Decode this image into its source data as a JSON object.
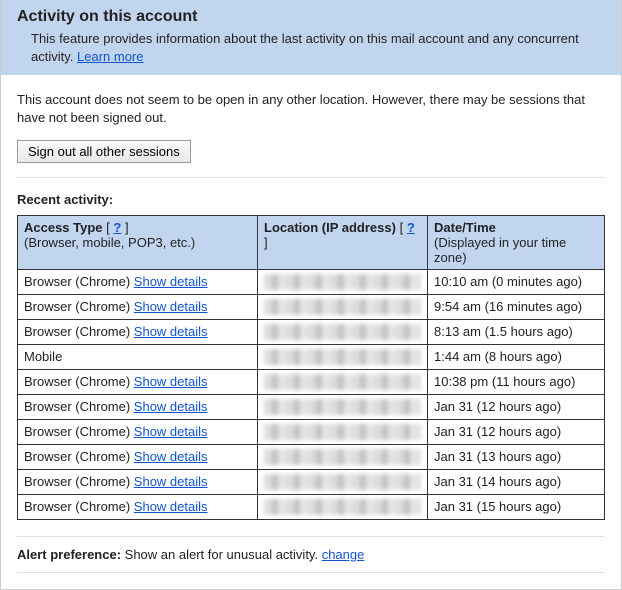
{
  "header": {
    "title": "Activity on this account",
    "subtitle_a": "This feature provides information about the last activity on this mail account and any concurrent activity. ",
    "learn_more": "Learn more"
  },
  "status": "This account does not seem to be open in any other location. However, there may be sessions that have not been signed out.",
  "signout_label": "Sign out all other sessions",
  "recent_label": "Recent activity:",
  "table": {
    "col_access_main": "Access Type",
    "col_access_sub": "(Browser, mobile, POP3, etc.)",
    "col_location_main": "Location (IP address)",
    "col_date_main": "Date/Time",
    "col_date_sub": "(Displayed in your time zone)",
    "help_q": "?",
    "show_details": "Show details",
    "rows": [
      {
        "access": "Browser (Chrome) ",
        "has_details": true,
        "datetime": "10:10 am (0 minutes ago)"
      },
      {
        "access": "Browser (Chrome) ",
        "has_details": true,
        "datetime": "9:54 am (16 minutes ago)"
      },
      {
        "access": "Browser (Chrome) ",
        "has_details": true,
        "datetime": "8:13 am (1.5 hours ago)"
      },
      {
        "access": "Mobile",
        "has_details": false,
        "datetime": "1:44 am (8 hours ago)"
      },
      {
        "access": "Browser (Chrome) ",
        "has_details": true,
        "datetime": "10:38 pm (11 hours ago)"
      },
      {
        "access": "Browser (Chrome) ",
        "has_details": true,
        "datetime": "Jan 31 (12 hours ago)"
      },
      {
        "access": "Browser (Chrome) ",
        "has_details": true,
        "datetime": "Jan 31 (12 hours ago)"
      },
      {
        "access": "Browser (Chrome) ",
        "has_details": true,
        "datetime": "Jan 31 (13 hours ago)"
      },
      {
        "access": "Browser (Chrome) ",
        "has_details": true,
        "datetime": "Jan 31 (14 hours ago)"
      },
      {
        "access": "Browser (Chrome) ",
        "has_details": true,
        "datetime": "Jan 31 (15 hours ago)"
      }
    ]
  },
  "alert": {
    "label": "Alert preference:",
    "text": " Show an alert for unusual activity.  ",
    "change": "change"
  }
}
